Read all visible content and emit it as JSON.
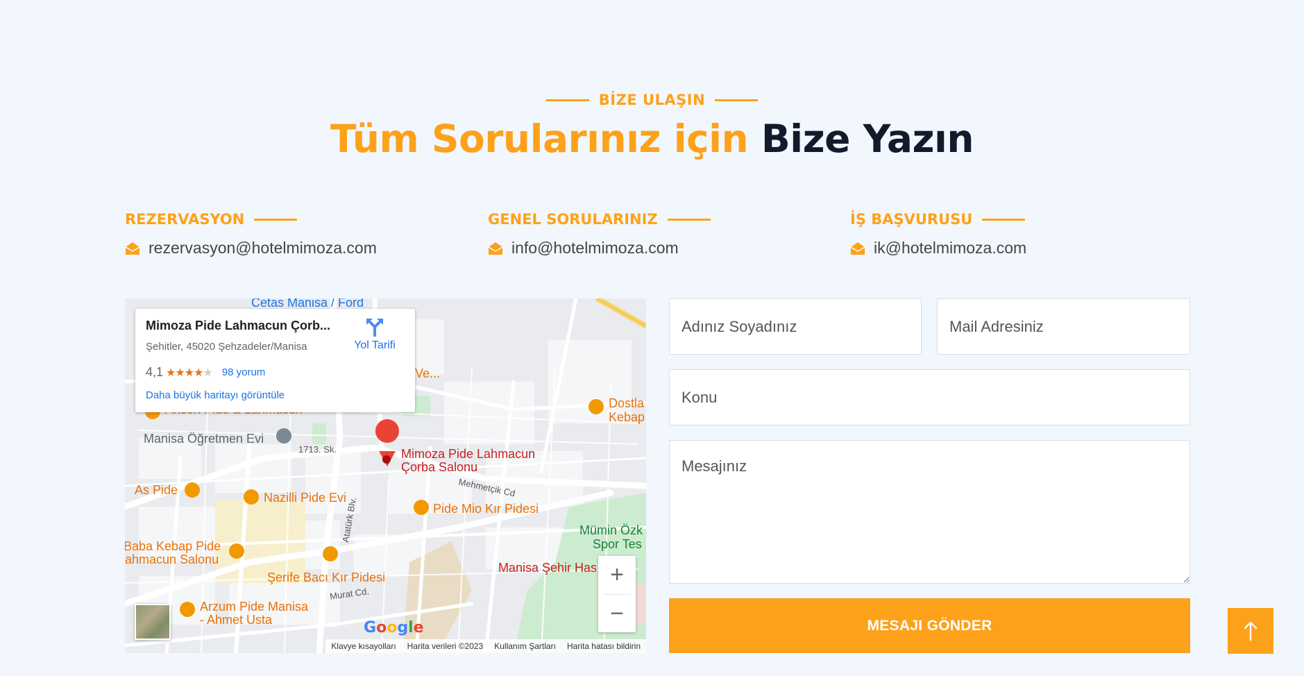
{
  "section": {
    "eyebrow": "BİZE ULAŞIN",
    "title_highlight": "Tüm Sorularınız için",
    "title_rest": "Bize Yazın"
  },
  "contacts": [
    {
      "title": "REZERVASYON",
      "email": "rezervasyon@hotelmimoza.com"
    },
    {
      "title": "GENEL SORULARINIZ",
      "email": "info@hotelmimoza.com"
    },
    {
      "title": "İŞ BAŞVURUSU",
      "email": "ik@hotelmimoza.com"
    }
  ],
  "map": {
    "card": {
      "name": "Mimoza Pide Lahmacun Çorb...",
      "address": "Şehitler, 45020 Şehzadeler/Manisa",
      "rating": "4,1",
      "stars": "★★★★",
      "star_empty": "★",
      "reviews": "98 yorum",
      "larger_map": "Daha büyük haritayı görüntüle",
      "directions": "Yol Tarifi"
    },
    "labels": {
      "cetas": "Cetas Manisa / Ford",
      "ve": "Ve...",
      "dostlar": "Dostla",
      "kebap": "Kebap",
      "ahsen": "Ahsen Pide & Lahmacun",
      "ogretmen": "Manisa Öğretmen Evi",
      "street_1713": "1713. Sk.",
      "mimoza_1": "Mimoza Pide Lahmacun",
      "mimoza_2": "Çorba Salonu",
      "mehmetcik": "Mehmetçik Cd",
      "as_pide": "As Pide",
      "nazilli": "Nazilli Pide Evi",
      "pide_mio": "Pide Mio Kır Pidesi",
      "mumin_1": "Mümin Özk",
      "mumin_2": "Spor Tes",
      "baba_1": "Baba Kebap Pide",
      "baba_2": "ahmacun Salonu",
      "ataturk": "Atatürk Blv.",
      "serife": "Şerife Bacı Kır Pidesi",
      "hastane": "Manisa Şehir Has",
      "murat": "Murat Cd.",
      "arzum_1": "Arzum Pide Manisa",
      "arzum_2": "- Ahmet Usta"
    },
    "google": "Google",
    "attribution": [
      "Klavye kısayolları",
      "Harita verileri ©2023",
      "Kullanım Şartları",
      "Harita hatası bildirin"
    ],
    "zoom_in": "+",
    "zoom_out": "−"
  },
  "form": {
    "name_placeholder": "Adınız Soyadınız",
    "email_placeholder": "Mail Adresiniz",
    "subject_placeholder": "Konu",
    "message_placeholder": "Mesajınız",
    "submit_label": "MESAJI GÖNDER"
  },
  "colors": {
    "accent": "#fea11a",
    "dark": "#141a2c",
    "background": "#f1f7fd"
  },
  "icons": {
    "mail": "mail-open-icon",
    "to_top": "arrow-up-icon"
  }
}
